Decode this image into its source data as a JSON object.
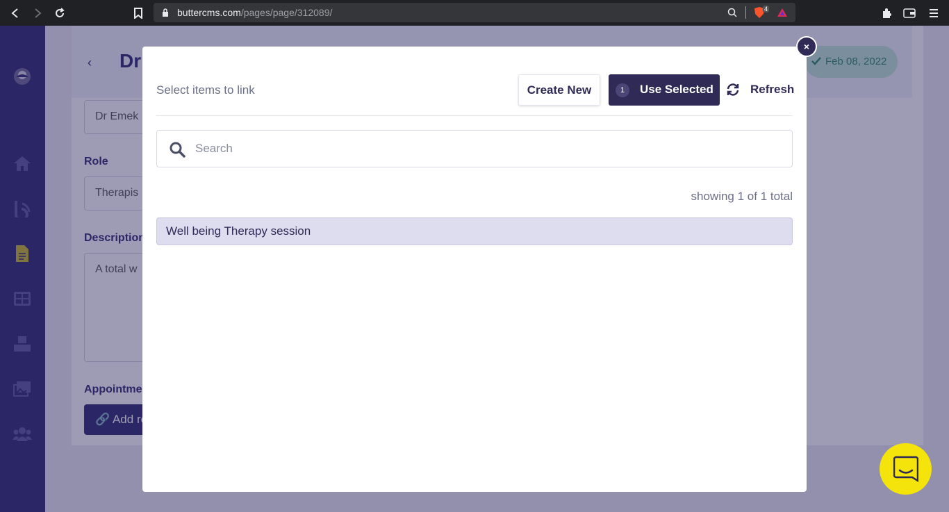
{
  "browser": {
    "url_host": "buttercms.com",
    "url_path": "/pages/page/312089/",
    "brave_badge": "4"
  },
  "sidebar": {
    "items": [
      {
        "icon": "butter-logo-icon"
      },
      {
        "icon": "home-icon"
      },
      {
        "icon": "blog-icon"
      },
      {
        "icon": "pages-icon"
      },
      {
        "icon": "collections-icon"
      },
      {
        "icon": "components-icon"
      },
      {
        "icon": "media-icon"
      },
      {
        "icon": "users-icon"
      }
    ]
  },
  "background_page": {
    "title": "Dr",
    "name_value": "Dr Emek",
    "role_label": "Role",
    "role_value": "Therapis",
    "description_label": "Description",
    "description_value": "A total w",
    "appointments_label": "Appointme",
    "add_button": "Add re",
    "date_badge": "Feb 08, 2022"
  },
  "modal": {
    "title": "Select items to link",
    "create_new": "Create New",
    "use_selected_count": "1",
    "use_selected": "Use Selected",
    "refresh": "Refresh",
    "search_placeholder": "Search",
    "showing": "showing 1 of 1 total",
    "results": [
      {
        "label": "Well being Therapy session",
        "selected": true
      }
    ],
    "close": "×"
  },
  "colors": {
    "brand": "#2e2870",
    "accent": "#2f2a56",
    "selected_row": "#dedcef",
    "chat": "#f5e30c"
  }
}
